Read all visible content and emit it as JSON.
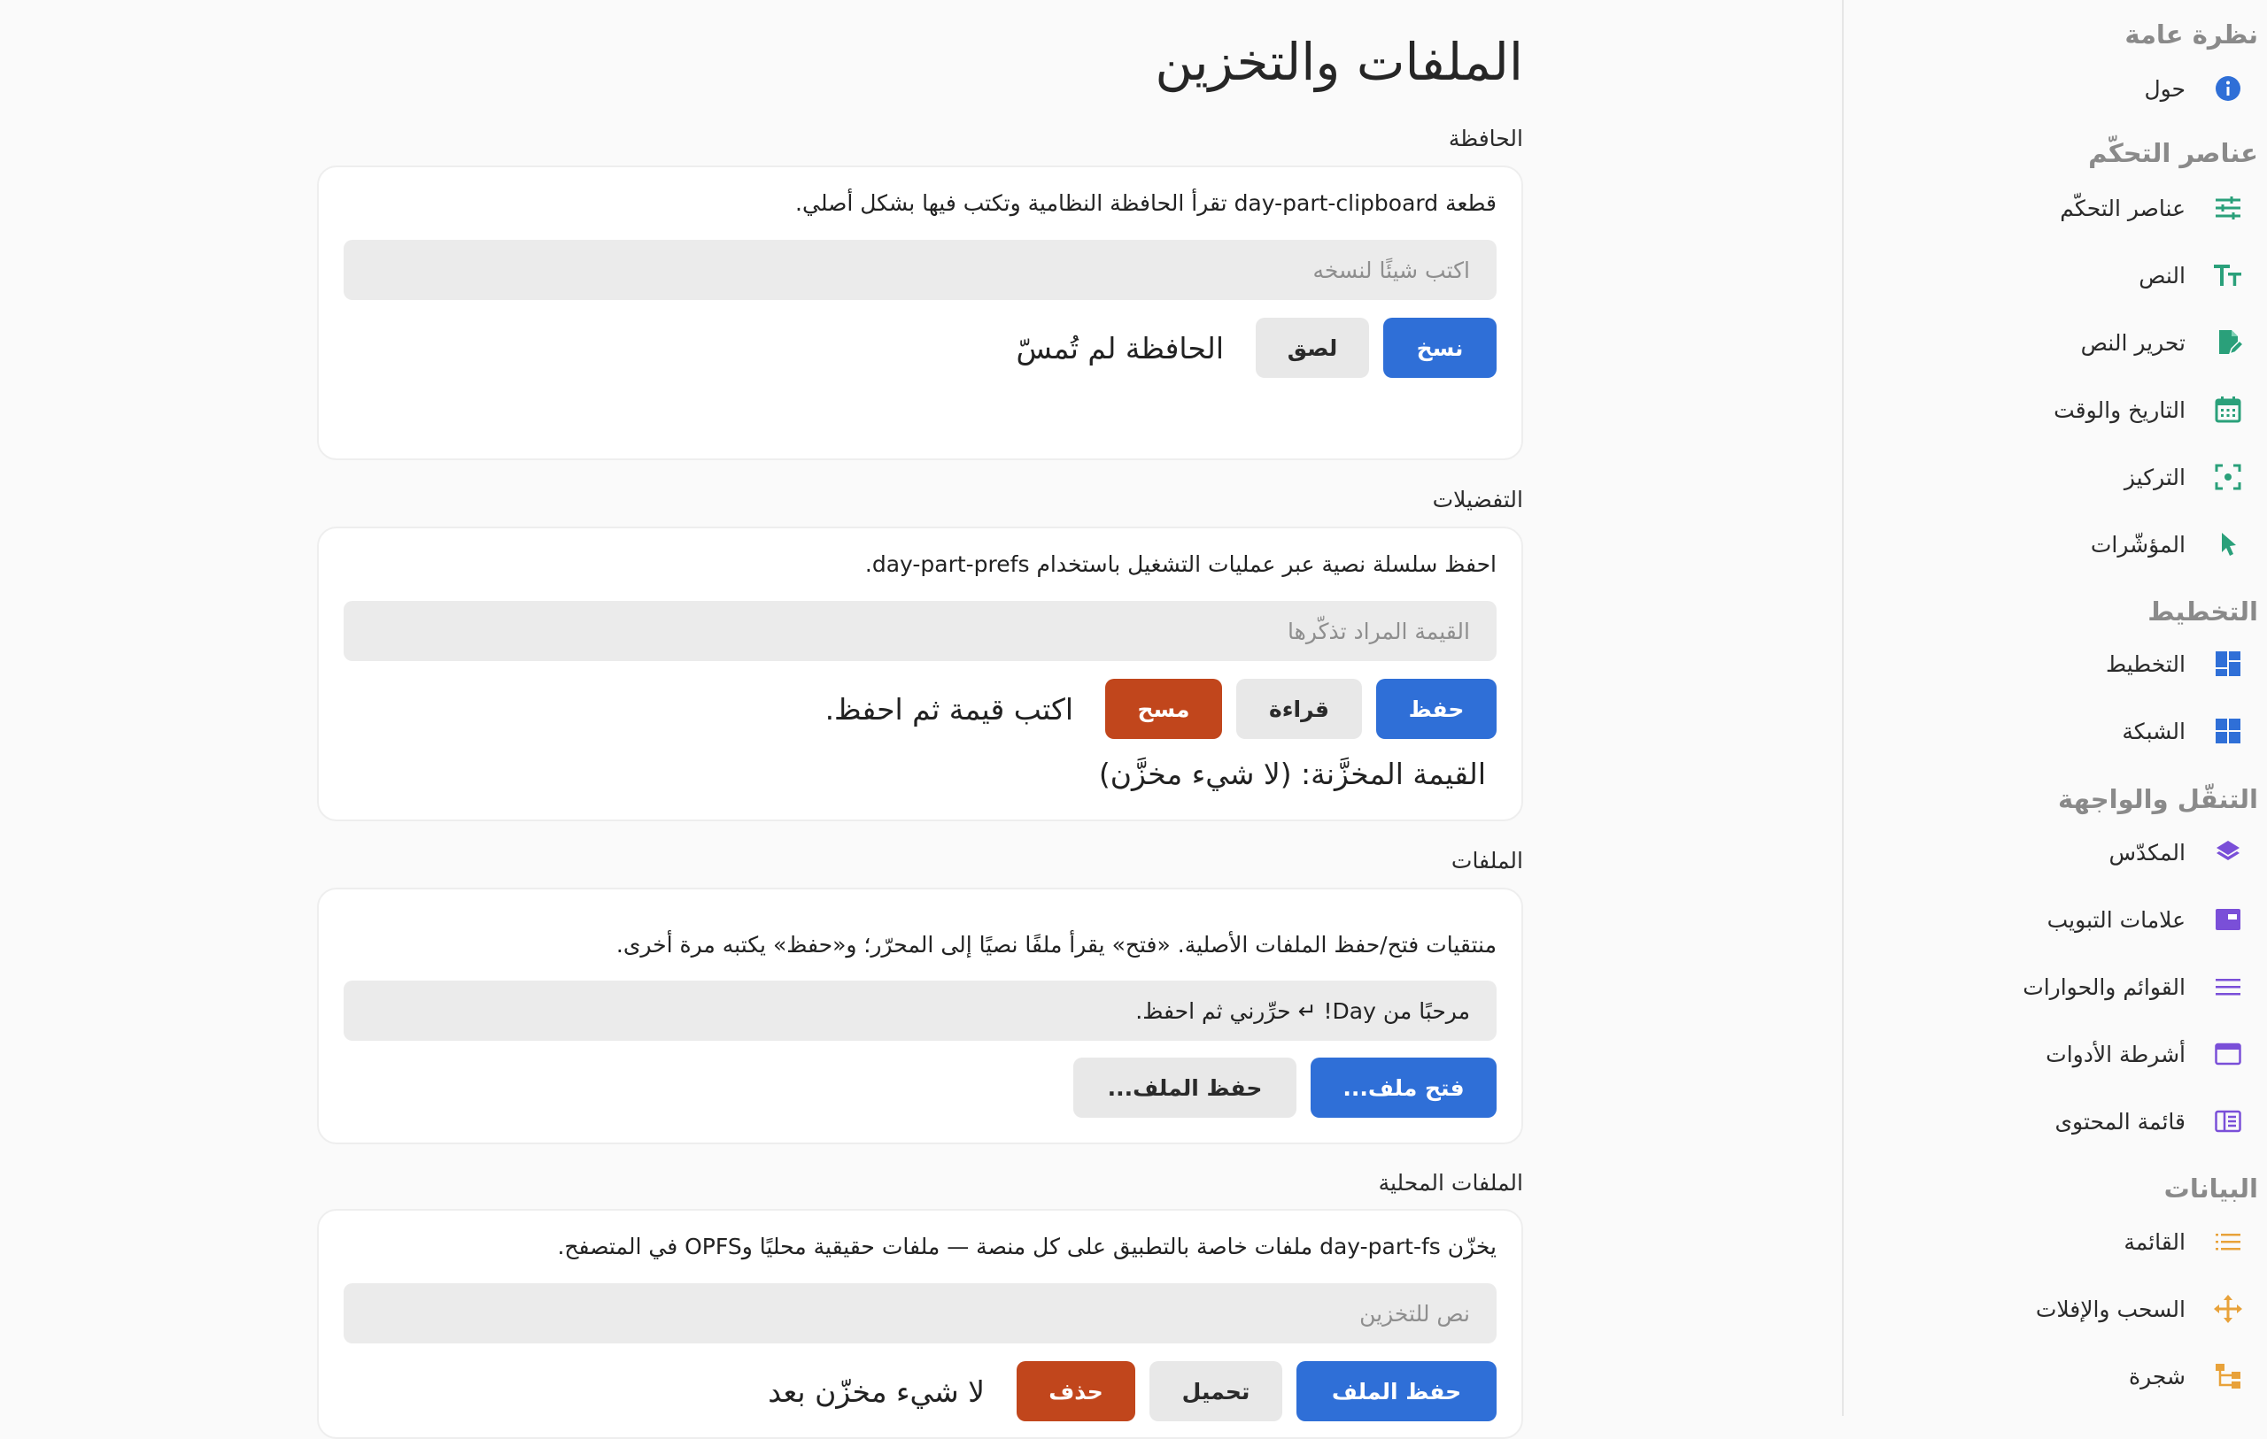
{
  "sidebar": {
    "sections": [
      {
        "title": "نظرة عامة",
        "items": [
          {
            "label": "حول",
            "icon": "info-icon",
            "color": "#2f6fd7"
          }
        ]
      },
      {
        "title": "عناصر التحكّم",
        "items": [
          {
            "label": "عناصر التحكّم",
            "icon": "sliders-icon",
            "color": "#2aa07a"
          },
          {
            "label": "النص",
            "icon": "text-size-icon",
            "color": "#2aa07a"
          },
          {
            "label": "تحرير النص",
            "icon": "edit-document-icon",
            "color": "#2aa07a"
          },
          {
            "label": "التاريخ والوقت",
            "icon": "calendar-icon",
            "color": "#2aa07a"
          },
          {
            "label": "التركيز",
            "icon": "focus-icon",
            "color": "#2aa07a"
          },
          {
            "label": "المؤشّرات",
            "icon": "pointer-icon",
            "color": "#2aa07a"
          }
        ]
      },
      {
        "title": "التخطيط",
        "items": [
          {
            "label": "التخطيط",
            "icon": "layout-icon",
            "color": "#2f6fd7"
          },
          {
            "label": "الشبكة",
            "icon": "grid-icon",
            "color": "#2f6fd7"
          }
        ]
      },
      {
        "title": "التنقّل والواجهة",
        "items": [
          {
            "label": "المكدّس",
            "icon": "stack-icon",
            "color": "#7a4fd8"
          },
          {
            "label": "علامات التبويب",
            "icon": "tabs-icon",
            "color": "#7a4fd8"
          },
          {
            "label": "القوائم والحوارات",
            "icon": "menu-icon",
            "color": "#7a4fd8"
          },
          {
            "label": "أشرطة الأدوات",
            "icon": "toolbar-icon",
            "color": "#7a4fd8"
          },
          {
            "label": "قائمة المحتوى",
            "icon": "sidebar-list-icon",
            "color": "#7a4fd8"
          }
        ]
      },
      {
        "title": "البيانات",
        "items": [
          {
            "label": "القائمة",
            "icon": "list-icon",
            "color": "#e8a23a"
          },
          {
            "label": "السحب والإفلات",
            "icon": "move-icon",
            "color": "#e8a23a"
          },
          {
            "label": "شجرة",
            "icon": "tree-icon",
            "color": "#e8a23a"
          }
        ]
      }
    ]
  },
  "main": {
    "title": "الملفات والتخزين",
    "clipboard": {
      "label": "الحافظة",
      "desc": "قطعة day-part-clipboard تقرأ الحافظة النظامية وتكتب فيها بشكل أصلي.",
      "placeholder": "اكتب شيئًا لنسخه",
      "copy": "نسخ",
      "paste": "لصق",
      "status": "الحافظة لم تُمسّ"
    },
    "prefs": {
      "label": "التفضيلات",
      "desc": "احفظ سلسلة نصية عبر عمليات التشغيل باستخدام day-part-prefs.",
      "placeholder": "القيمة المراد تذكّرها",
      "save": "حفظ",
      "read": "قراءة",
      "clear": "مسح",
      "status": "اكتب قيمة ثم احفظ.",
      "stored": "القيمة المخزَّنة:  (لا شيء مخزَّن)"
    },
    "files": {
      "label": "الملفات",
      "desc": "منتقيات فتح/حفظ الملفات الأصلية. «فتح» يقرأ ملفًا نصيًا إلى المحرّر؛ و«حفظ» يكتبه مرة أخرى.",
      "value": "مرحبًا من Day! ↵ حرِّرني ثم احفظ.",
      "open": "فتح ملف...",
      "save_as": "حفظ الملف..."
    },
    "local_files": {
      "label": "الملفات المحلية",
      "desc": "يخزّن day-part-fs ملفات خاصة بالتطبيق على كل منصة — ملفات حقيقية محليًا وOPFS في المتصفح.",
      "placeholder": "نص للتخزين",
      "save": "حفظ الملف",
      "load": "تحميل",
      "delete": "حذف",
      "status": "لا شيء مخزّن بعد"
    }
  }
}
